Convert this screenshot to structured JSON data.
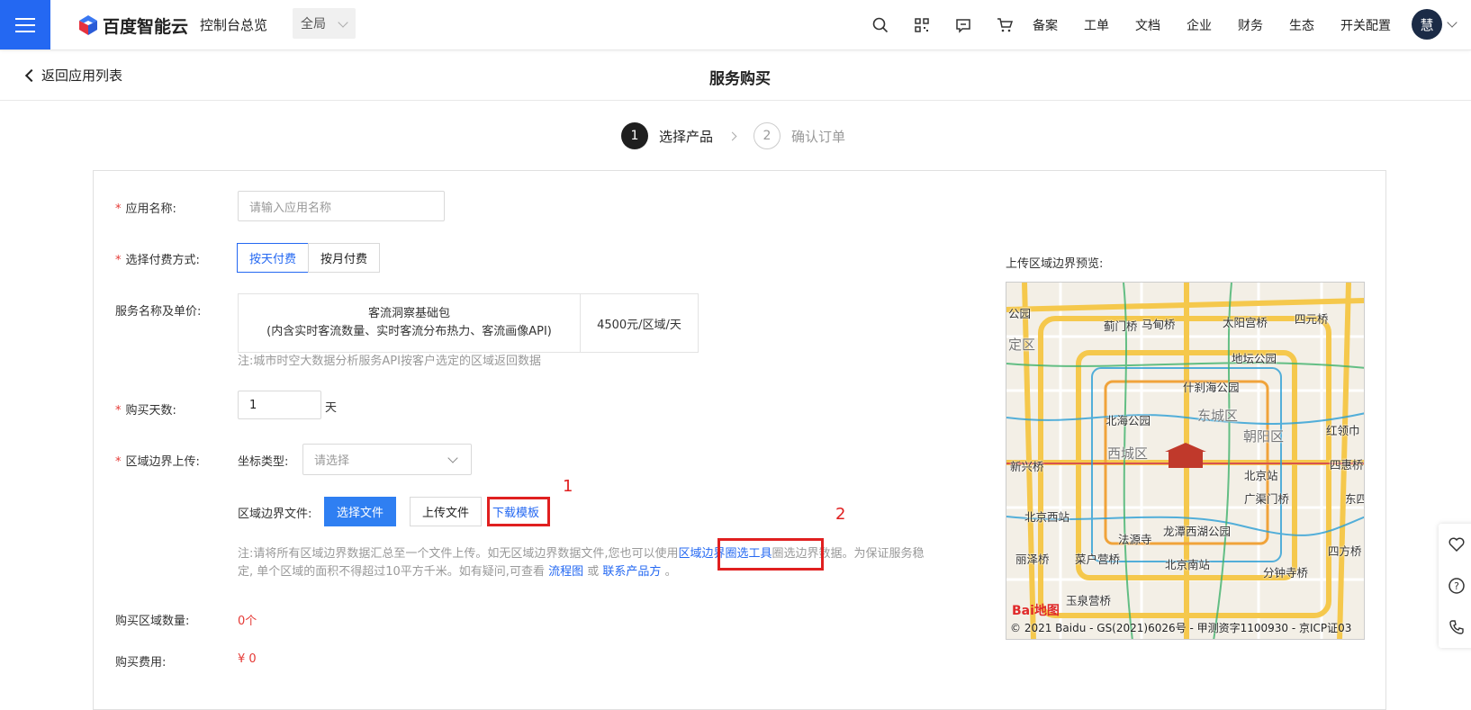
{
  "topbar": {
    "brand": "百度智能云",
    "console_label": "控制台总览",
    "scope_value": "全局",
    "nav_items": [
      "备案",
      "工单",
      "文档",
      "企业",
      "财务",
      "生态",
      "开关配置"
    ],
    "avatar_char": "慧",
    "icons": [
      "search-icon",
      "qrcode-icon",
      "message-icon",
      "cart-icon"
    ]
  },
  "subbar": {
    "back_label": "返回应用列表",
    "title": "服务购买"
  },
  "steps": [
    {
      "num": "1",
      "label": "选择产品",
      "active": true
    },
    {
      "num": "2",
      "label": "确认订单",
      "active": false
    }
  ],
  "form": {
    "app_name_label": "应用名称:",
    "app_name_placeholder": "请输入应用名称",
    "pay_method_label": "选择付费方式:",
    "pay_daily": "按天付费",
    "pay_monthly": "按月付费",
    "service_label": "服务名称及单价:",
    "service_name": "客流洞察基础包",
    "service_desc": "(内含实时客流数量、实时客流分布热力、客流画像API)",
    "service_price": "4500元/区域/天",
    "service_note": "注:城市时空大数据分析服务API按客户选定的区域返回数据",
    "days_label": "购买天数:",
    "days_value": "1",
    "days_unit": "天",
    "boundary_label": "区域边界上传:",
    "coord_label": "坐标类型:",
    "coord_placeholder": "请选择",
    "file_label": "区域边界文件:",
    "choose_file": "选择文件",
    "upload_file": "上传文件",
    "download_template": "下载模板",
    "note_part1": "注:请将所有区域边界数据汇总至一个文件上传。如无区域边界数据文件,您也可以使用",
    "note_link_tool": "区域边界圈选工具",
    "note_part2": "圈选边界数据。为保证服务稳",
    "note_part3": "定, 单个区域的面积不得超过10平方千米。如有疑问,可查看",
    "note_link_flow": "流程图",
    "note_or": "或",
    "note_link_contact": "联系产品方",
    "note_end": "。",
    "count_label": "购买区域数量:",
    "count_value": "0个",
    "fee_label": "购买费用:",
    "fee_value": "¥ 0"
  },
  "annotations": {
    "n1": "1",
    "n2": "2"
  },
  "map": {
    "label": "上传区域边界预览:",
    "places": [
      "公园",
      "蓟门桥",
      "马甸桥",
      "太阳宫桥",
      "四元桥",
      "定区",
      "地坛公园",
      "什刹海公园",
      "东城区",
      "北海公园",
      "朝阳区",
      "红领巾",
      "西城区",
      "新兴桥",
      "北京站",
      "四惠桥",
      "广渠门桥",
      "北京西站",
      "东四环",
      "法源寺",
      "龙潭西湖公园",
      "丽泽桥",
      "菜户营桥",
      "北京南站",
      "四方桥",
      "分钟寺桥",
      "玉泉营桥"
    ],
    "brand": "Bai地图",
    "copyright": "© 2021 Baidu - GS(2021)6026号 - 甲测资字1100930 - 京ICP证03"
  },
  "colors": {
    "accent": "#2468f2",
    "danger": "#e02020"
  }
}
